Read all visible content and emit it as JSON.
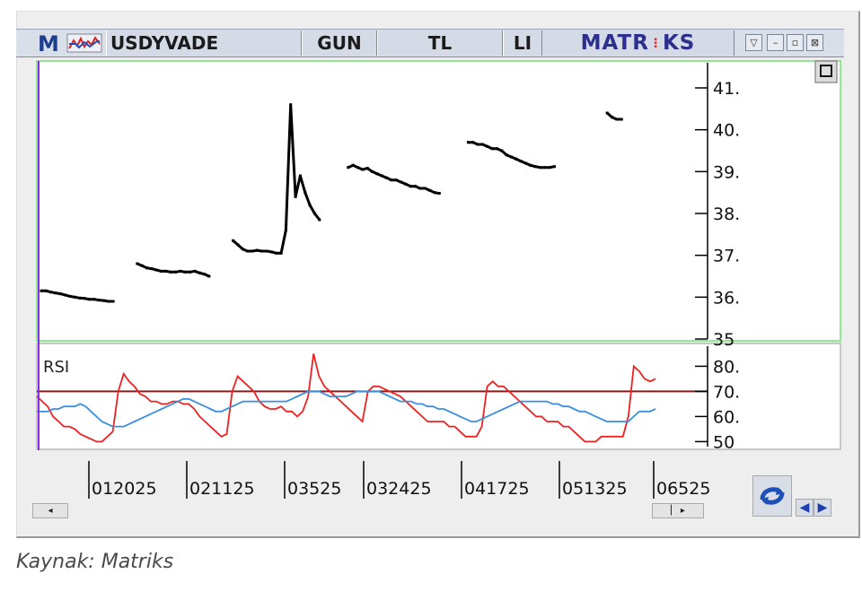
{
  "toolbar": {
    "logo": "M",
    "symbol": "USDYVADE",
    "period": "GUN",
    "currency": "TL",
    "extra": "LI",
    "brand_left": "MATR",
    "brand_right": "KS"
  },
  "caption": "Kaynak: Matriks",
  "colors": {
    "price": "#000000",
    "rsi": "#ee2222",
    "rsi_signal": "#3a8fe0",
    "threshold": "#8b1a1a",
    "frame_green": "#90e890",
    "cursor": "#8a2be2"
  },
  "chart_data": [
    {
      "type": "line",
      "panel": "price",
      "y_ticks": [
        "41.",
        "40.",
        "39.",
        "38.",
        "37.",
        "36.",
        "35"
      ],
      "ylim": [
        35,
        41.6
      ],
      "x_tick_labels": [
        "012025",
        "021125",
        "03525",
        "032425",
        "041725",
        "051325",
        "06525"
      ],
      "series": [
        {
          "x": [
            0,
            1,
            2,
            3,
            4,
            5,
            6,
            7,
            8,
            9,
            10,
            11,
            12,
            13,
            14,
            15,
            16,
            17,
            18,
            19,
            20,
            21,
            22,
            23,
            24,
            25,
            26,
            27,
            28,
            29,
            30,
            31,
            32,
            33,
            34,
            35,
            36,
            37,
            38,
            39,
            40,
            41,
            42,
            43,
            44,
            45,
            46,
            47,
            48,
            49,
            50,
            51,
            52,
            53,
            54,
            55,
            56,
            57,
            58,
            59,
            60,
            61,
            62,
            63,
            64,
            65,
            66,
            67,
            68,
            69,
            70,
            71,
            72,
            73,
            74,
            75,
            76,
            77,
            78,
            79,
            80,
            81,
            82,
            83,
            84,
            85,
            86,
            87,
            88,
            89,
            90,
            91,
            92,
            93,
            94,
            95,
            96,
            97,
            98,
            99,
            100,
            101,
            102,
            103,
            104,
            105,
            106,
            107,
            108,
            109,
            110,
            111,
            112,
            113,
            114,
            115,
            116,
            117,
            118,
            119,
            120,
            121,
            122,
            123,
            124,
            125,
            126,
            127,
            128,
            129
          ],
          "values": [
            36.15,
            36.15,
            36.12,
            36.1,
            36.08,
            36.05,
            36.02,
            36.0,
            35.98,
            35.97,
            35.95,
            35.95,
            35.93,
            35.92,
            35.9,
            35.9,
            null,
            null,
            null,
            null,
            36.8,
            36.75,
            36.7,
            36.68,
            36.65,
            36.62,
            36.62,
            36.6,
            36.6,
            36.62,
            36.6,
            36.6,
            36.62,
            36.58,
            36.55,
            36.5,
            null,
            null,
            null,
            null,
            37.35,
            37.25,
            37.15,
            37.1,
            37.1,
            37.12,
            37.1,
            37.1,
            37.08,
            37.05,
            37.05,
            37.6,
            40.6,
            38.4,
            38.9,
            38.5,
            38.2,
            38.0,
            37.85,
            null,
            null,
            null,
            null,
            null,
            39.1,
            39.15,
            39.1,
            39.05,
            39.08,
            39.0,
            38.95,
            38.9,
            38.85,
            38.8,
            38.8,
            38.75,
            38.7,
            38.65,
            38.65,
            38.6,
            38.6,
            38.55,
            38.5,
            38.48,
            null,
            null,
            null,
            null,
            null,
            39.7,
            39.7,
            39.65,
            39.65,
            39.6,
            39.55,
            39.55,
            39.5,
            39.4,
            39.35,
            39.3,
            39.25,
            39.2,
            39.15,
            39.12,
            39.1,
            39.1,
            39.1,
            39.12,
            null,
            null,
            null,
            null,
            null,
            null,
            null,
            null,
            null,
            null,
            40.4,
            40.3,
            40.25,
            40.25,
            null,
            null,
            null,
            null,
            null,
            null,
            null,
            null
          ],
          "name": ""
        }
      ]
    },
    {
      "type": "line",
      "panel": "rsi",
      "title": "RSI",
      "y_ticks": [
        "80.",
        "70.",
        "60.",
        "50"
      ],
      "ylim": [
        48,
        88
      ],
      "threshold": 70,
      "series": [
        {
          "name": "",
          "values": [
            68,
            66,
            64,
            60,
            58,
            56,
            56,
            55,
            53,
            52,
            51,
            50,
            50,
            52,
            54,
            70,
            77,
            74,
            72,
            69,
            68,
            66,
            66,
            65,
            65,
            66,
            66,
            65,
            65,
            63,
            60,
            58,
            56,
            54,
            52,
            53,
            70,
            76,
            74,
            72,
            70,
            66,
            64,
            63,
            63,
            64,
            62,
            62,
            60,
            62,
            68,
            85,
            76,
            72,
            70,
            68,
            66,
            64,
            62,
            60,
            58,
            70,
            72,
            72,
            71,
            70,
            69,
            68,
            66,
            64,
            62,
            60,
            58,
            58,
            58,
            58,
            56,
            56,
            54,
            52,
            52,
            52,
            56,
            72,
            74,
            72,
            72,
            70,
            68,
            66,
            64,
            62,
            60,
            60,
            58,
            58,
            58,
            56,
            56,
            54,
            52,
            50,
            50,
            50,
            52,
            52,
            52,
            52,
            52,
            60,
            80,
            78,
            75,
            74,
            75
          ]
        },
        {
          "name": "",
          "values": [
            62,
            62,
            62,
            63,
            63,
            64,
            64,
            64,
            65,
            64,
            62,
            60,
            58,
            57,
            56,
            56,
            56,
            57,
            58,
            59,
            60,
            61,
            62,
            63,
            64,
            65,
            66,
            67,
            67,
            66,
            65,
            64,
            63,
            62,
            62,
            63,
            64,
            65,
            66,
            66,
            66,
            66,
            66,
            66,
            66,
            66,
            66,
            67,
            68,
            69,
            70,
            70,
            70,
            69,
            68,
            68,
            68,
            68,
            69,
            70,
            70,
            70,
            70,
            70,
            69,
            68,
            67,
            66,
            66,
            66,
            65,
            65,
            64,
            64,
            63,
            63,
            62,
            61,
            60,
            59,
            58,
            58,
            59,
            60,
            61,
            62,
            63,
            64,
            65,
            66,
            66,
            66,
            66,
            66,
            66,
            65,
            65,
            64,
            64,
            63,
            62,
            62,
            61,
            60,
            59,
            58,
            58,
            58,
            58,
            58,
            60,
            62,
            62,
            62,
            63
          ]
        }
      ]
    }
  ]
}
